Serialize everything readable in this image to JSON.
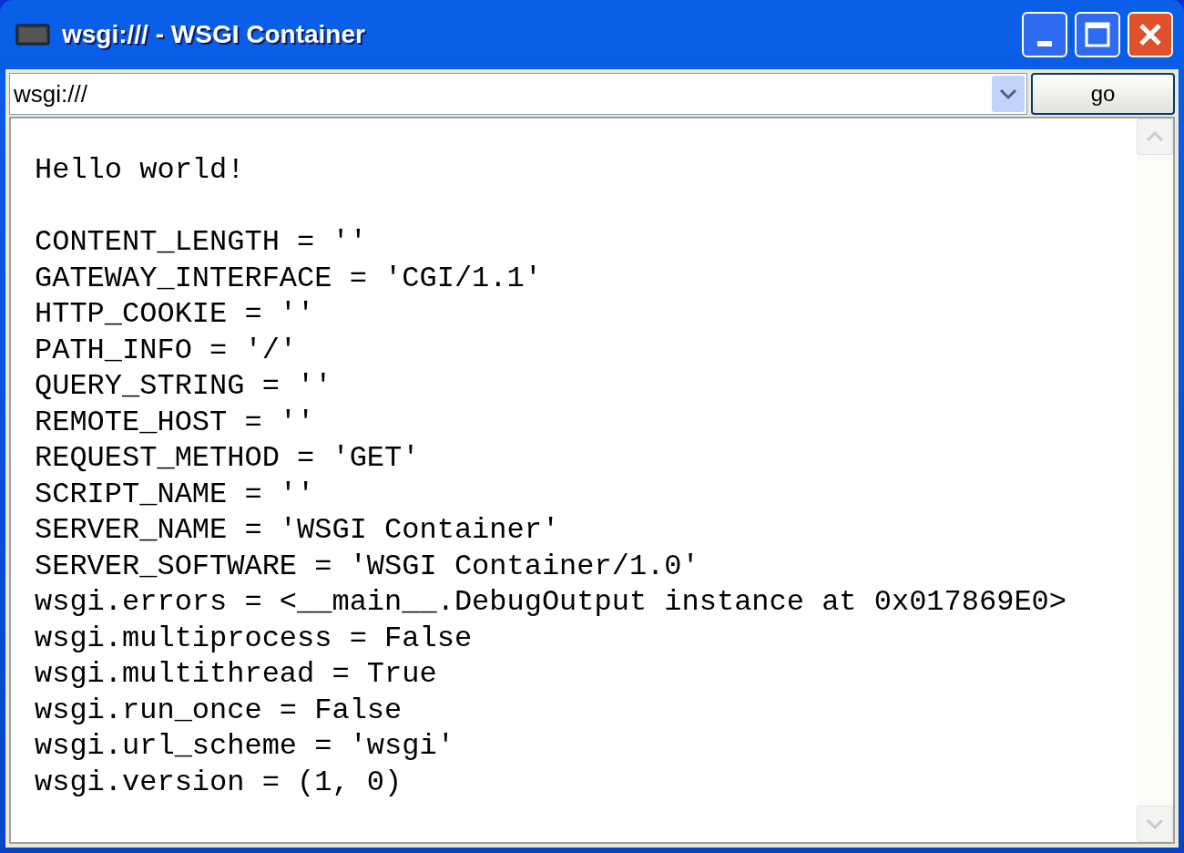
{
  "window": {
    "title": "wsgi:/// - WSGI Container"
  },
  "address": {
    "value": "wsgi:///"
  },
  "go_button": {
    "label": "go"
  },
  "content": {
    "greeting": "Hello world!",
    "environ": [
      "CONTENT_LENGTH = ''",
      "GATEWAY_INTERFACE = 'CGI/1.1'",
      "HTTP_COOKIE = ''",
      "PATH_INFO = '/'",
      "QUERY_STRING = ''",
      "REMOTE_HOST = ''",
      "REQUEST_METHOD = 'GET'",
      "SCRIPT_NAME = ''",
      "SERVER_NAME = 'WSGI Container'",
      "SERVER_SOFTWARE = 'WSGI Container/1.0'",
      "wsgi.errors = <__main__.DebugOutput instance at 0x017869E0>",
      "wsgi.multiprocess = False",
      "wsgi.multithread = True",
      "wsgi.run_once = False",
      "wsgi.url_scheme = 'wsgi'",
      "wsgi.version = (1, 0)"
    ]
  }
}
